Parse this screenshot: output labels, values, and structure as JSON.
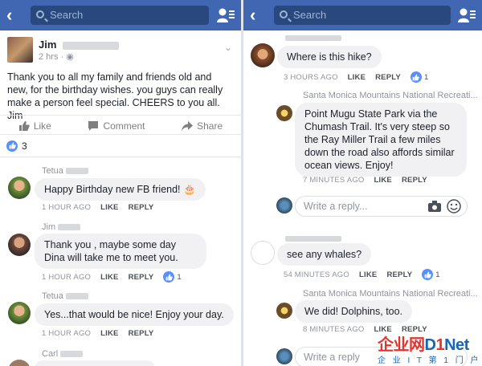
{
  "left": {
    "search_placeholder": "Search",
    "post": {
      "author": "Jim",
      "time": "2 hrs ·",
      "text": "Thank you to all my family and friends old and new, for the birthday wishes. you guys can really make a person feel special. CHEERS to you all. Jim",
      "actions": [
        "Like",
        "Comment",
        "Share"
      ],
      "reaction_count": "3"
    },
    "comments": [
      {
        "name": "Tetua",
        "text": "Happy Birthday new FB friend! 🎂",
        "time": "1 HOUR AGO",
        "like": "LIKE",
        "reply": "REPLY"
      },
      {
        "name": "Jim",
        "text": "Thank you , maybe some day Dina will take me to meet you.",
        "time": "1 HOUR AGO",
        "like": "LIKE",
        "reply": "REPLY",
        "likes": "1"
      },
      {
        "name": "Tetua",
        "text": "Yes...that would be nice! Enjoy your day.",
        "time": "1 HOUR AGO",
        "like": "LIKE",
        "reply": "REPLY"
      },
      {
        "name": "Carl"
      }
    ]
  },
  "right": {
    "search_placeholder": "Search",
    "comments": [
      {
        "text": "Where is this hike?",
        "time": "3 HOURS AGO",
        "like": "LIKE",
        "reply": "REPLY",
        "likes": "1"
      },
      {
        "name": "Santa Monica Mountains National Recreati...",
        "text": "Point Mugu State Park via the Chumash Trail. It's very steep so the Ray Miller Trail a few miles down the road also affords similar ocean views. Enjoy!",
        "time": "7 MINUTES AGO",
        "like": "LIKE",
        "reply": "REPLY"
      },
      {
        "text": "see any whales?",
        "time": "54 MINUTES AGO",
        "like": "LIKE",
        "reply": "REPLY",
        "likes": "1"
      },
      {
        "name": "Santa Monica Mountains National Recreati...",
        "text": "We did! Dolphins, too.",
        "time": "8 MINUTES AGO",
        "like": "LIKE",
        "reply": "REPLY"
      }
    ],
    "reply_placeholder": "Write a reply...",
    "reply_placeholder_2": "Write a reply"
  },
  "watermark": {
    "main_a": "企业网",
    "main_b": "D",
    "main_c": "1",
    "main_d": "Net",
    "sub": "企 业 I T 第 1 门 户"
  },
  "colors": {
    "topbar": "#4267b2",
    "search_bg": "#29487d",
    "bubble": "#f1f0f3",
    "like_blue": "#5890ff"
  }
}
